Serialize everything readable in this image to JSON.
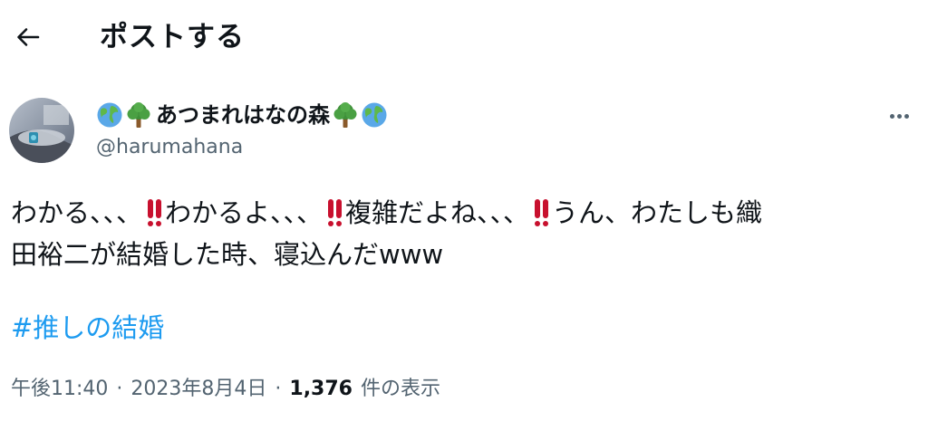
{
  "header": {
    "back_icon": "arrow-left-icon",
    "title": "ポストする"
  },
  "author": {
    "avatar_icon": "avatar",
    "name_prefix_emojis": [
      "globe-icon",
      "tree-icon"
    ],
    "display_name": "あつまれはなの森",
    "name_suffix_emojis": [
      "tree-icon",
      "globe-icon"
    ],
    "handle": "@harumahana"
  },
  "more_icon": "more-dots-icon",
  "tweet": {
    "line1": {
      "seg1": "わかる、、、",
      "seg2": "わかるよ、、、",
      "seg3": "複雑だよね、、、",
      "seg4": "うん、わたしも織"
    },
    "line2": "田裕二が結婚した時、寝込んだwww",
    "emoji": "double-exclamation-icon",
    "hashtag": "#推しの結婚"
  },
  "meta": {
    "time": "午後11:40",
    "separator": "·",
    "date": "2023年8月4日",
    "views_count": "1,376",
    "views_label": "件の表示"
  },
  "colors": {
    "text": "#0f1419",
    "secondary": "#536471",
    "link": "#1d9bf0",
    "emoji_red": "#c8102e"
  }
}
